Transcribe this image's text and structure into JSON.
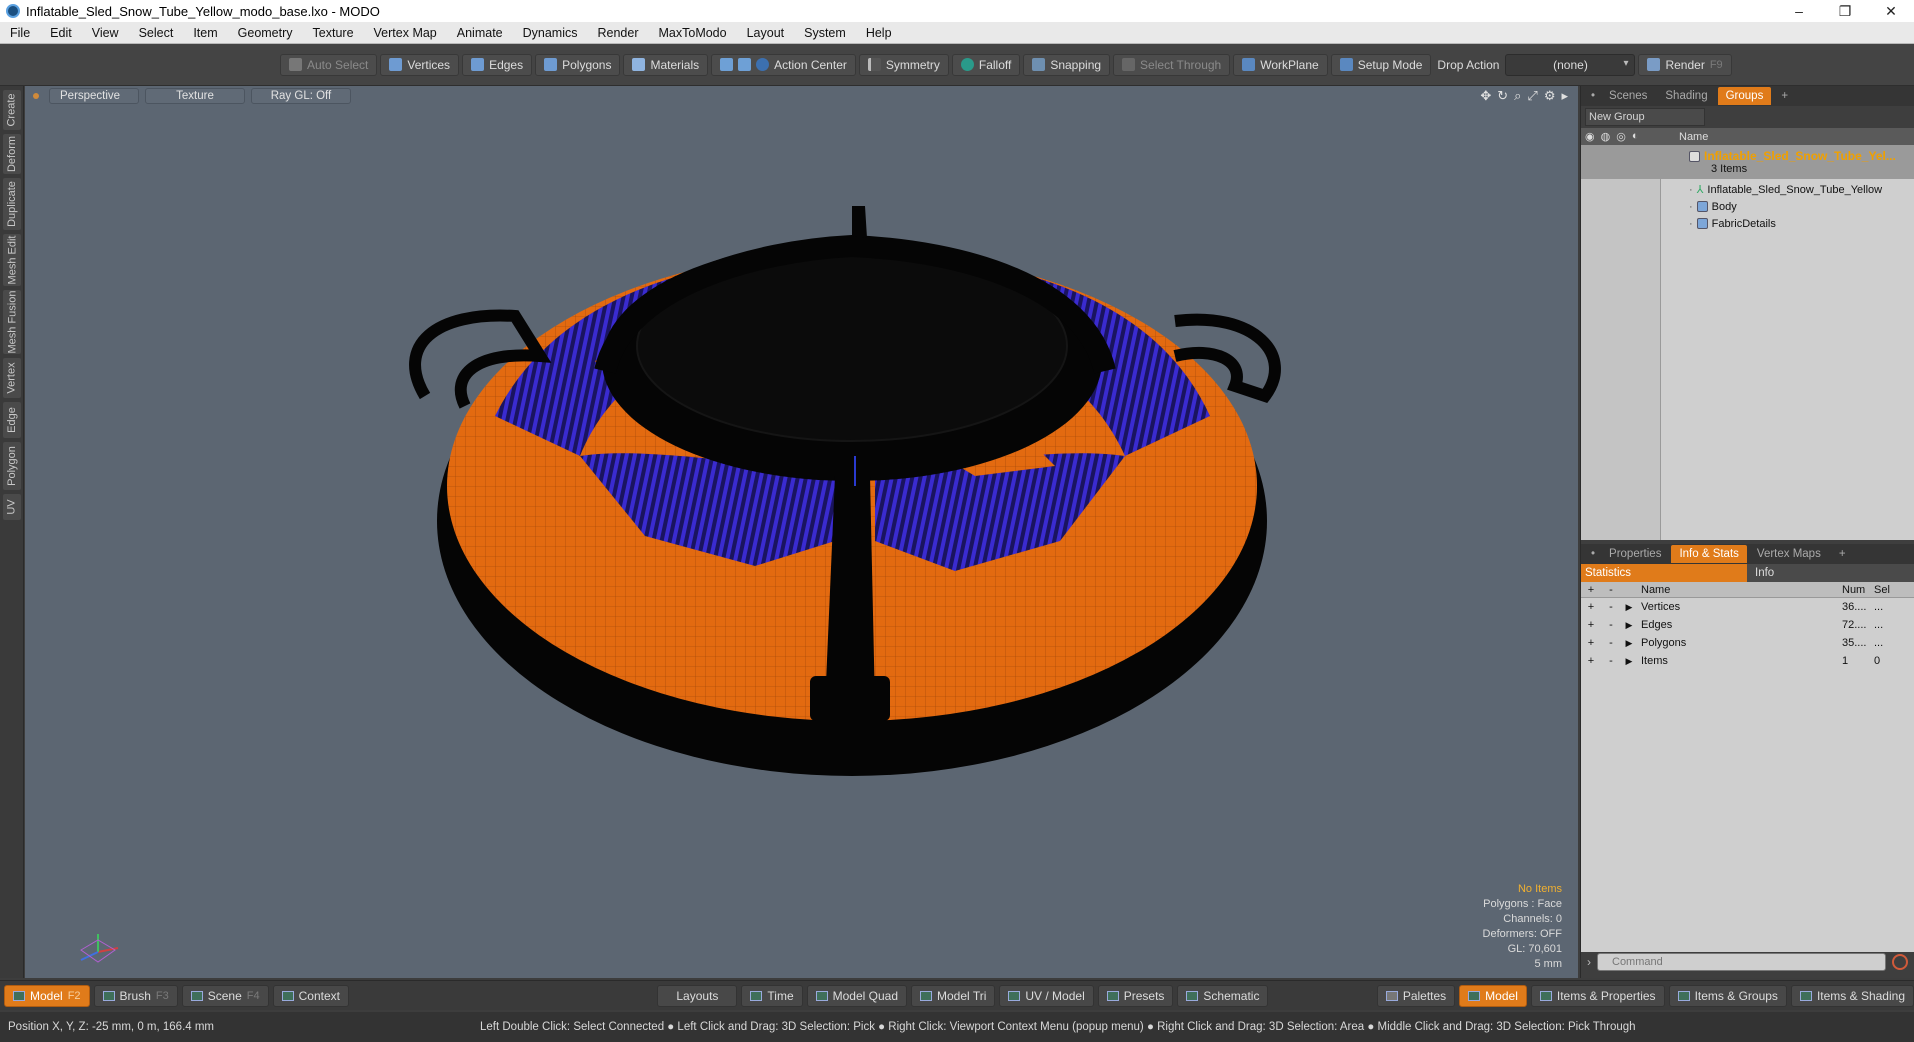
{
  "window": {
    "title": "Inflatable_Sled_Snow_Tube_Yellow_modo_base.lxo - MODO",
    "min": "–",
    "max": "❐",
    "close": "✕"
  },
  "menu": [
    "File",
    "Edit",
    "View",
    "Select",
    "Item",
    "Geometry",
    "Texture",
    "Vertex Map",
    "Animate",
    "Dynamics",
    "Render",
    "MaxToModo",
    "Layout",
    "System",
    "Help"
  ],
  "toolbar": {
    "auto_select": "Auto Select",
    "vertices": "Vertices",
    "edges": "Edges",
    "polygons": "Polygons",
    "materials": "Materials",
    "action_center": "Action Center",
    "symmetry": "Symmetry",
    "falloff": "Falloff",
    "snapping": "Snapping",
    "select_through": "Select Through",
    "workplane": "WorkPlane",
    "setup_mode": "Setup Mode",
    "drop_action_label": "Drop Action",
    "drop_action_value": "(none)",
    "render": "Render",
    "render_key": "F9"
  },
  "left_tabs": [
    "Create",
    "Deform",
    "Duplicate",
    "Mesh Edit",
    "Mesh Fusion",
    "Vertex",
    "Edge",
    "Polygon",
    "UV"
  ],
  "viewport": {
    "view": "Perspective",
    "shading": "Texture",
    "raygl": "Ray GL: Off",
    "stats": {
      "items": "No Items",
      "polygons": "Polygons : Face",
      "channels": "Channels: 0",
      "deformers": "Deformers: OFF",
      "gl": "GL: 70,601",
      "grid": "5 mm"
    }
  },
  "scene_panel": {
    "tabs": [
      "Scenes",
      "Shading",
      "Groups"
    ],
    "active_tab": "Groups",
    "new_group": "New Group",
    "col_name": "Name",
    "root_name": "Inflatable_Sled_Snow_Tube_Yel...",
    "root_count": "3 Items",
    "children": [
      "Inflatable_Sled_Snow_Tube_Yellow",
      "Body",
      "FabricDetails"
    ]
  },
  "stats_panel": {
    "tabs": [
      "Properties",
      "Info & Stats",
      "Vertex Maps"
    ],
    "active_tab": "Info & Stats",
    "sub_left": "Statistics",
    "sub_right": "Info",
    "headers": {
      "name": "Name",
      "num": "Num",
      "sel": "Sel"
    },
    "rows": [
      {
        "name": "Vertices",
        "num": "36....",
        "sel": "..."
      },
      {
        "name": "Edges",
        "num": "72....",
        "sel": "..."
      },
      {
        "name": "Polygons",
        "num": "35....",
        "sel": "..."
      },
      {
        "name": "Items",
        "num": "1",
        "sel": "0"
      }
    ],
    "command_placeholder": "Command"
  },
  "bottom_bar": {
    "model": "Model",
    "model_key": "F2",
    "brush": "Brush",
    "brush_key": "F3",
    "scene": "Scene",
    "scene_key": "F4",
    "context": "Context",
    "layouts": "Layouts",
    "time": "Time",
    "model_quad": "Model Quad",
    "model_tri": "Model Tri",
    "uv_model": "UV / Model",
    "presets": "Presets",
    "schematic": "Schematic",
    "palettes": "Palettes",
    "model_right": "Model",
    "items_properties": "Items & Properties",
    "items_groups": "Items & Groups",
    "items_shading": "Items & Shading"
  },
  "status": {
    "position": "Position X, Y, Z:   -25 mm, 0 m, 166.4 mm",
    "hint": "Left Double Click: Select Connected ● Left Click and Drag: 3D Selection: Pick ● Right Click: Viewport Context Menu (popup menu) ● Right Click and Drag: 3D Selection: Area ● Middle Click and Drag: 3D Selection: Pick Through"
  },
  "colors": {
    "accent": "#e07b1a",
    "viewport_bg": "#5c6672",
    "tube_orange": "#e36a10",
    "stripe_blue": "#3a2bd0"
  }
}
